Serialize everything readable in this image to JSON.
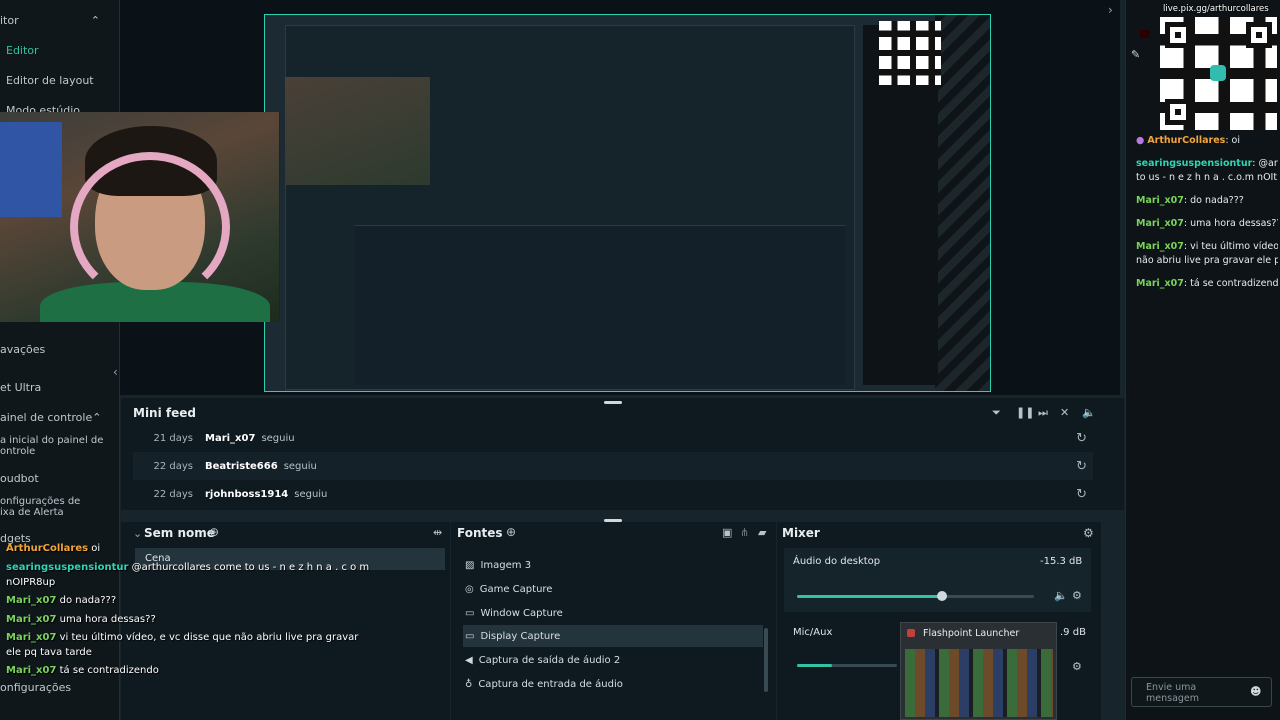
{
  "sidebar": {
    "items": [
      {
        "label": "itor"
      },
      {
        "label": "Editor"
      },
      {
        "label": "Editor de layout"
      },
      {
        "label": "Modo estúdio"
      },
      {
        "label": "avações"
      },
      {
        "label": "et Ultra"
      },
      {
        "label": "ainel de controle"
      },
      {
        "label": "a inicial do painel de\nontrole"
      },
      {
        "label": "oudbot"
      },
      {
        "label": "onfigurações de\nixa de Alerta"
      },
      {
        "label": "dgets"
      },
      {
        "label": "onfigurações"
      }
    ]
  },
  "minifeed": {
    "title": "Mini feed",
    "rows": [
      {
        "days": "21 days",
        "user": "Mari_x07",
        "action": "seguiu"
      },
      {
        "days": "22 days",
        "user": "Beatriste666",
        "action": "seguiu"
      },
      {
        "days": "22 days",
        "user": "rjohnboss1914",
        "action": "seguiu"
      }
    ]
  },
  "scenes": {
    "title": "Sem nome",
    "items": [
      "Cena"
    ]
  },
  "sources": {
    "title": "Fontes",
    "items": [
      {
        "label": "Imagem 3",
        "icon": "image-icon"
      },
      {
        "label": "Game Capture",
        "icon": "gamepad-icon"
      },
      {
        "label": "Window Capture",
        "icon": "window-icon"
      },
      {
        "label": "Display Capture",
        "icon": "monitor-icon"
      },
      {
        "label": "Captura de saída de áudio 2",
        "icon": "speaker-icon"
      },
      {
        "label": "Captura de entrada de áudio",
        "icon": "microphone-icon"
      }
    ]
  },
  "mixer": {
    "title": "Mixer",
    "channels": [
      {
        "name": "Áudio do desktop",
        "db": "-15.3 dB",
        "level": 0.61
      },
      {
        "name": "Mic/Aux",
        "db": ".9 dB",
        "level": 0.35
      }
    ]
  },
  "overlay_chat": [
    {
      "user": "ArthurCollares",
      "text": "oi",
      "color": "orange"
    },
    {
      "user": "searingsuspensiontur",
      "text": "@arthurcollares come to us - n e z h n a . c o m",
      "color": "teal"
    },
    {
      "user": "",
      "text": "nOIPR8up",
      "color": ""
    },
    {
      "user": "Mari_x07",
      "text": "do nada???",
      "color": "green"
    },
    {
      "user": "Mari_x07",
      "text": "uma hora dessas??",
      "color": "green"
    },
    {
      "user": "Mari_x07",
      "text": "vi teu último vídeo, e vc disse que não abriu live pra gravar",
      "color": "green"
    },
    {
      "user": "",
      "text": "ele pq tava tarde",
      "color": ""
    },
    {
      "user": "Mari_x07",
      "text": "tá se contradizendo",
      "color": "green"
    }
  ],
  "right_chat": {
    "pix_label": "live.pix.gg/arthurcollares",
    "messages": [
      {
        "user": "ArthurCollares",
        "text": ": oi"
      },
      {
        "user": "searingsuspensiontur",
        "text": ": @arthur"
      },
      {
        "user": "",
        "text": "to us - n e z h n a . c.o.m nOItP"
      },
      {
        "user": "Mari_x07",
        "text": ": do nada???"
      },
      {
        "user": "Mari_x07",
        "text": ": uma hora dessas??"
      },
      {
        "user": "Mari_x07",
        "text": ": vi teu último vídeo, e"
      },
      {
        "user": "",
        "text": "não abriu live pra gravar ele pq"
      },
      {
        "user": "Mari_x07",
        "text": ": tá se contradizendo"
      }
    ],
    "input_placeholder": "Envie uma mensagem"
  },
  "popup": {
    "title": "Flashpoint Launcher"
  },
  "colors": {
    "accent": "#31c3a2",
    "panel": "#0f1a20",
    "background": "#17242b"
  }
}
